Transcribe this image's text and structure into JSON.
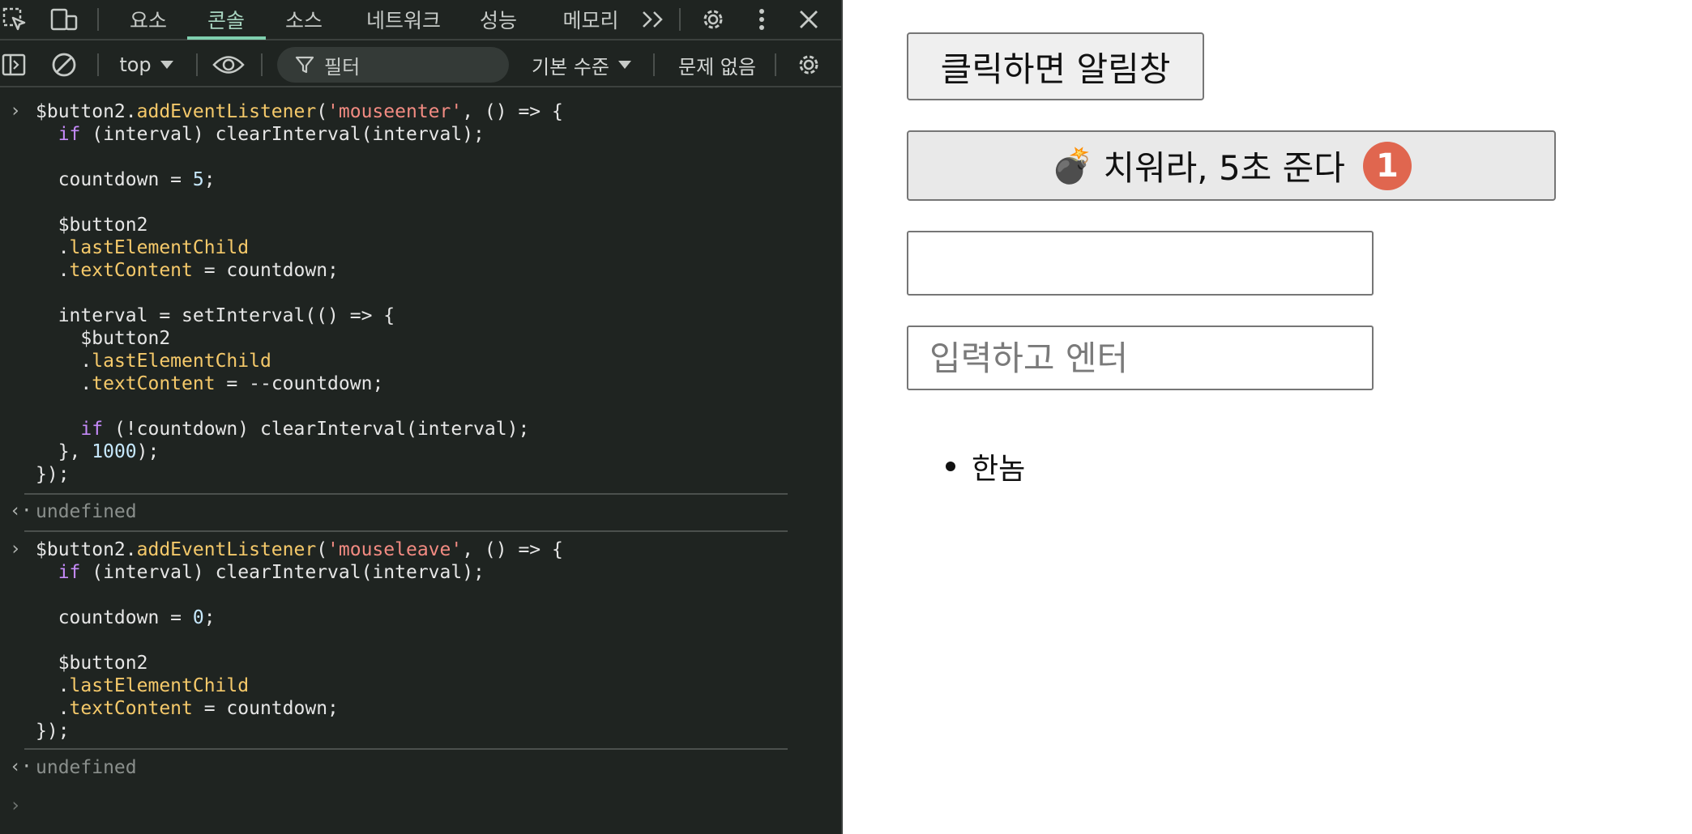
{
  "devtools": {
    "tabs": [
      {
        "label": "요소"
      },
      {
        "label": "콘솔"
      },
      {
        "label": "소스"
      },
      {
        "label": "네트워크"
      },
      {
        "label": "성능"
      },
      {
        "label": "메모리"
      }
    ],
    "active_tab_index": 1,
    "toolbar": {
      "context": "top",
      "filter_placeholder": "필터",
      "level": "기본 수준",
      "issues": "문제 없음"
    },
    "console": {
      "result_text": "undefined"
    },
    "icons": [
      "inspect-icon",
      "device-toolbar-icon",
      "more-tabs-icon",
      "settings-icon",
      "kebab-menu-icon",
      "close-icon",
      "sidebar-toggle-icon",
      "clear-console-icon",
      "eye-icon",
      "filter-icon",
      "console-settings-icon"
    ]
  },
  "page": {
    "alert_button_label": "클릭하면 알림창",
    "bomb_button": {
      "emoji": "💣",
      "label": "치워라, 5초 준다",
      "badge": "1",
      "badge_color": "#e0664f"
    },
    "input1_value": "",
    "input2_placeholder": "입력하고 엔터",
    "list_items": [
      "한놈"
    ]
  }
}
